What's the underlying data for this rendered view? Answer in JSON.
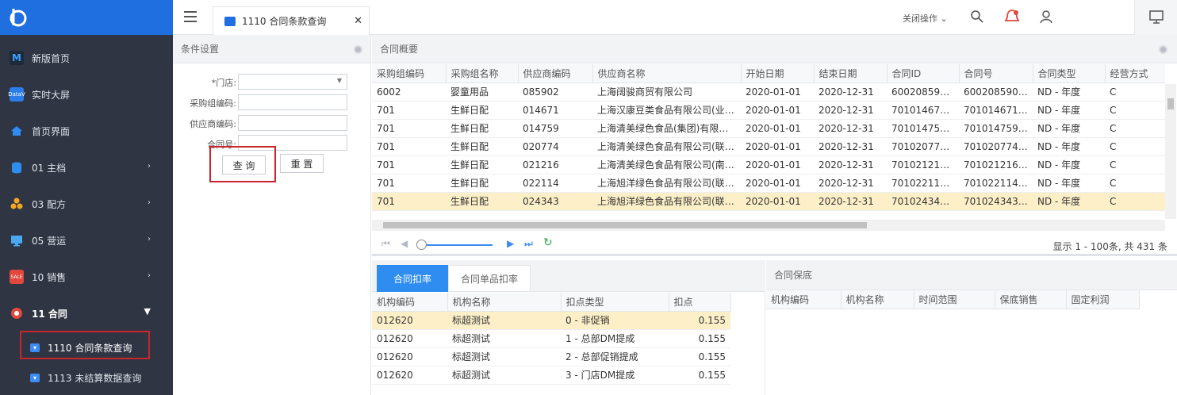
{
  "sidebar": {
    "items": [
      {
        "label": "新版首页",
        "icon": "m-icon"
      },
      {
        "label": "实时大屏",
        "icon": "datav-icon"
      },
      {
        "label": "首页界面",
        "icon": "home-icon"
      },
      {
        "label": "01 主档",
        "icon": "database-icon"
      },
      {
        "label": "03 配方",
        "icon": "recipe-icon"
      },
      {
        "label": "05 营运",
        "icon": "monitor-icon"
      },
      {
        "label": "10 销售",
        "icon": "sale-icon"
      },
      {
        "label": "11 合同",
        "icon": "contract-icon"
      }
    ],
    "sub_items": [
      {
        "label": "1110 合同条款查询"
      },
      {
        "label": "1113 未结算数据查询"
      }
    ]
  },
  "topbar": {
    "tab_label": "1110 合同条款查询",
    "close_ops": "关闭操作 ⌄"
  },
  "conditions": {
    "title": "条件设置",
    "store_label": "*门店:",
    "buyer_code_label": "采购组编码:",
    "supplier_code_label": "供应商编码:",
    "contract_no_label": "合同号:",
    "query_button": "查 询",
    "reset_button": "重 置"
  },
  "overview": {
    "title": "合同概要",
    "columns": [
      "采购组编码",
      "采购组名称",
      "供应商编码",
      "供应商名称",
      "开始日期",
      "结束日期",
      "合同ID",
      "合同号",
      "合同类型",
      "经营方式"
    ],
    "rows": [
      [
        "6002",
        "婴童用品",
        "085902",
        "上海阔骏商贸有限公司",
        "2020-01-01",
        "2020-12-31",
        "60020859022...",
        "60020859022...",
        "ND - 年度",
        "C"
      ],
      [
        "701",
        "生鲜日配",
        "014671",
        "上海汉康豆类食品有限公司(业务...",
        "2020-01-01",
        "2020-12-31",
        "70101467120...",
        "70101467120...",
        "ND - 年度",
        "C"
      ],
      [
        "701",
        "生鲜日配",
        "014759",
        "上海清美绿色食品(集团)有限公司",
        "2020-01-01",
        "2020-12-31",
        "70101475920...",
        "70101475920...",
        "ND - 年度",
        "C"
      ],
      [
        "701",
        "生鲜日配",
        "020774",
        "上海清美绿色食品有限公司(联销)",
        "2020-01-01",
        "2020-12-31",
        "70102077420...",
        "70102077420...",
        "ND - 年度",
        "C"
      ],
      [
        "701",
        "生鲜日配",
        "021216",
        "上海清美绿色食品有限公司(南京)(...",
        "2020-01-01",
        "2020-12-31",
        "70102121620...",
        "70102121620...",
        "ND - 年度",
        "C"
      ],
      [
        "701",
        "生鲜日配",
        "022114",
        "上海旭洋绿色食品有限公司(联营)",
        "2020-01-01",
        "2020-12-31",
        "70102211420...",
        "70102211420...",
        "ND - 年度",
        "C"
      ],
      [
        "701",
        "生鲜日配",
        "024343",
        "上海旭洋绿色食品有限公司(联销)",
        "2020-01-01",
        "2020-12-31",
        "70102434320...",
        "70102434320...",
        "ND - 年度",
        "C"
      ]
    ],
    "pager_text": "显示 1 - 100条, 共 431 条"
  },
  "deduct": {
    "tab_active": "合同扣率",
    "tab_inactive": "合同单品扣率",
    "columns": [
      "机构编码",
      "机构名称",
      "扣点类型",
      "扣点"
    ],
    "rows": [
      [
        "012620",
        "标超测试",
        "0 - 非促销",
        "0.155"
      ],
      [
        "012620",
        "标超测试",
        "1 - 总部DM提成",
        "0.155"
      ],
      [
        "012620",
        "标超测试",
        "2 - 总部促销提成",
        "0.155"
      ],
      [
        "012620",
        "标超测试",
        "3 - 门店DM提成",
        "0.155"
      ]
    ]
  },
  "guarantee": {
    "title": "合同保底",
    "columns": [
      "机构编码",
      "机构名称",
      "时间范围",
      "保底销售",
      "固定利润"
    ]
  },
  "colors": {
    "sidebar_bg": "#2f3542",
    "brand_blue": "#1f6fe0",
    "highlight": "#fdf0c8",
    "focus_red": "#c8262c"
  }
}
